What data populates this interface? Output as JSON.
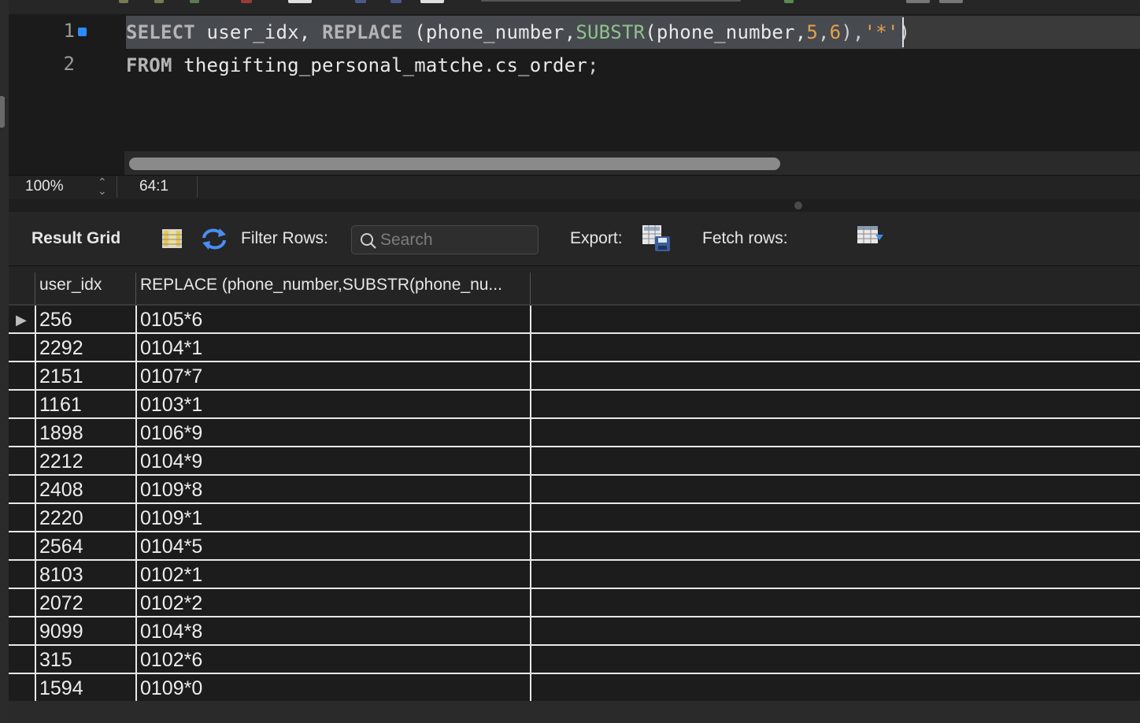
{
  "editor": {
    "line_numbers": [
      "1",
      "2"
    ],
    "line1": {
      "kw_select": "SELECT",
      "col_user_idx": " user_idx, ",
      "kw_replace": "REPLACE",
      "rep_open": " (phone_number,",
      "fn_substr": "SUBSTR",
      "substr_open": "(phone_number,",
      "num_5": "5",
      "comma": ",",
      "num_6": "6",
      "close": ")",
      "comma2": ",",
      "str_star": "'*'",
      "close2": ")"
    },
    "line2": {
      "kw_from": "FROM",
      "table": " thegifting_personal_matche",
      "dot": ".",
      "table2": "cs_order",
      "semi": ";"
    }
  },
  "status": {
    "zoom": "100%",
    "cursor_position": "64:1"
  },
  "result_toolbar": {
    "result_grid_label": "Result Grid",
    "filter_rows_label": "Filter Rows:",
    "search_placeholder": "Search",
    "export_label": "Export:",
    "fetch_rows_label": "Fetch rows:"
  },
  "grid": {
    "columns": [
      "user_idx",
      "REPLACE (phone_number,SUBSTR(phone_nu..."
    ],
    "rows": [
      [
        "256",
        "0105*6"
      ],
      [
        "2292",
        "0104*1"
      ],
      [
        "2151",
        "0107*7"
      ],
      [
        "1161",
        "0103*1"
      ],
      [
        "1898",
        "0106*9"
      ],
      [
        "2212",
        "0104*9"
      ],
      [
        "2408",
        "0109*8"
      ],
      [
        "2220",
        "0109*1"
      ],
      [
        "2564",
        "0104*5"
      ],
      [
        "8103",
        "0102*1"
      ],
      [
        "2072",
        "0102*2"
      ],
      [
        "9099",
        "0104*8"
      ],
      [
        "315",
        "0102*6"
      ],
      [
        "1594",
        "0109*0"
      ]
    ]
  },
  "colors": {
    "background": "#1e1e1e",
    "keyword": "#b4b4b4",
    "function": "#8fc28b",
    "number": "#e5a04a",
    "bullet": "#2a8cff"
  }
}
